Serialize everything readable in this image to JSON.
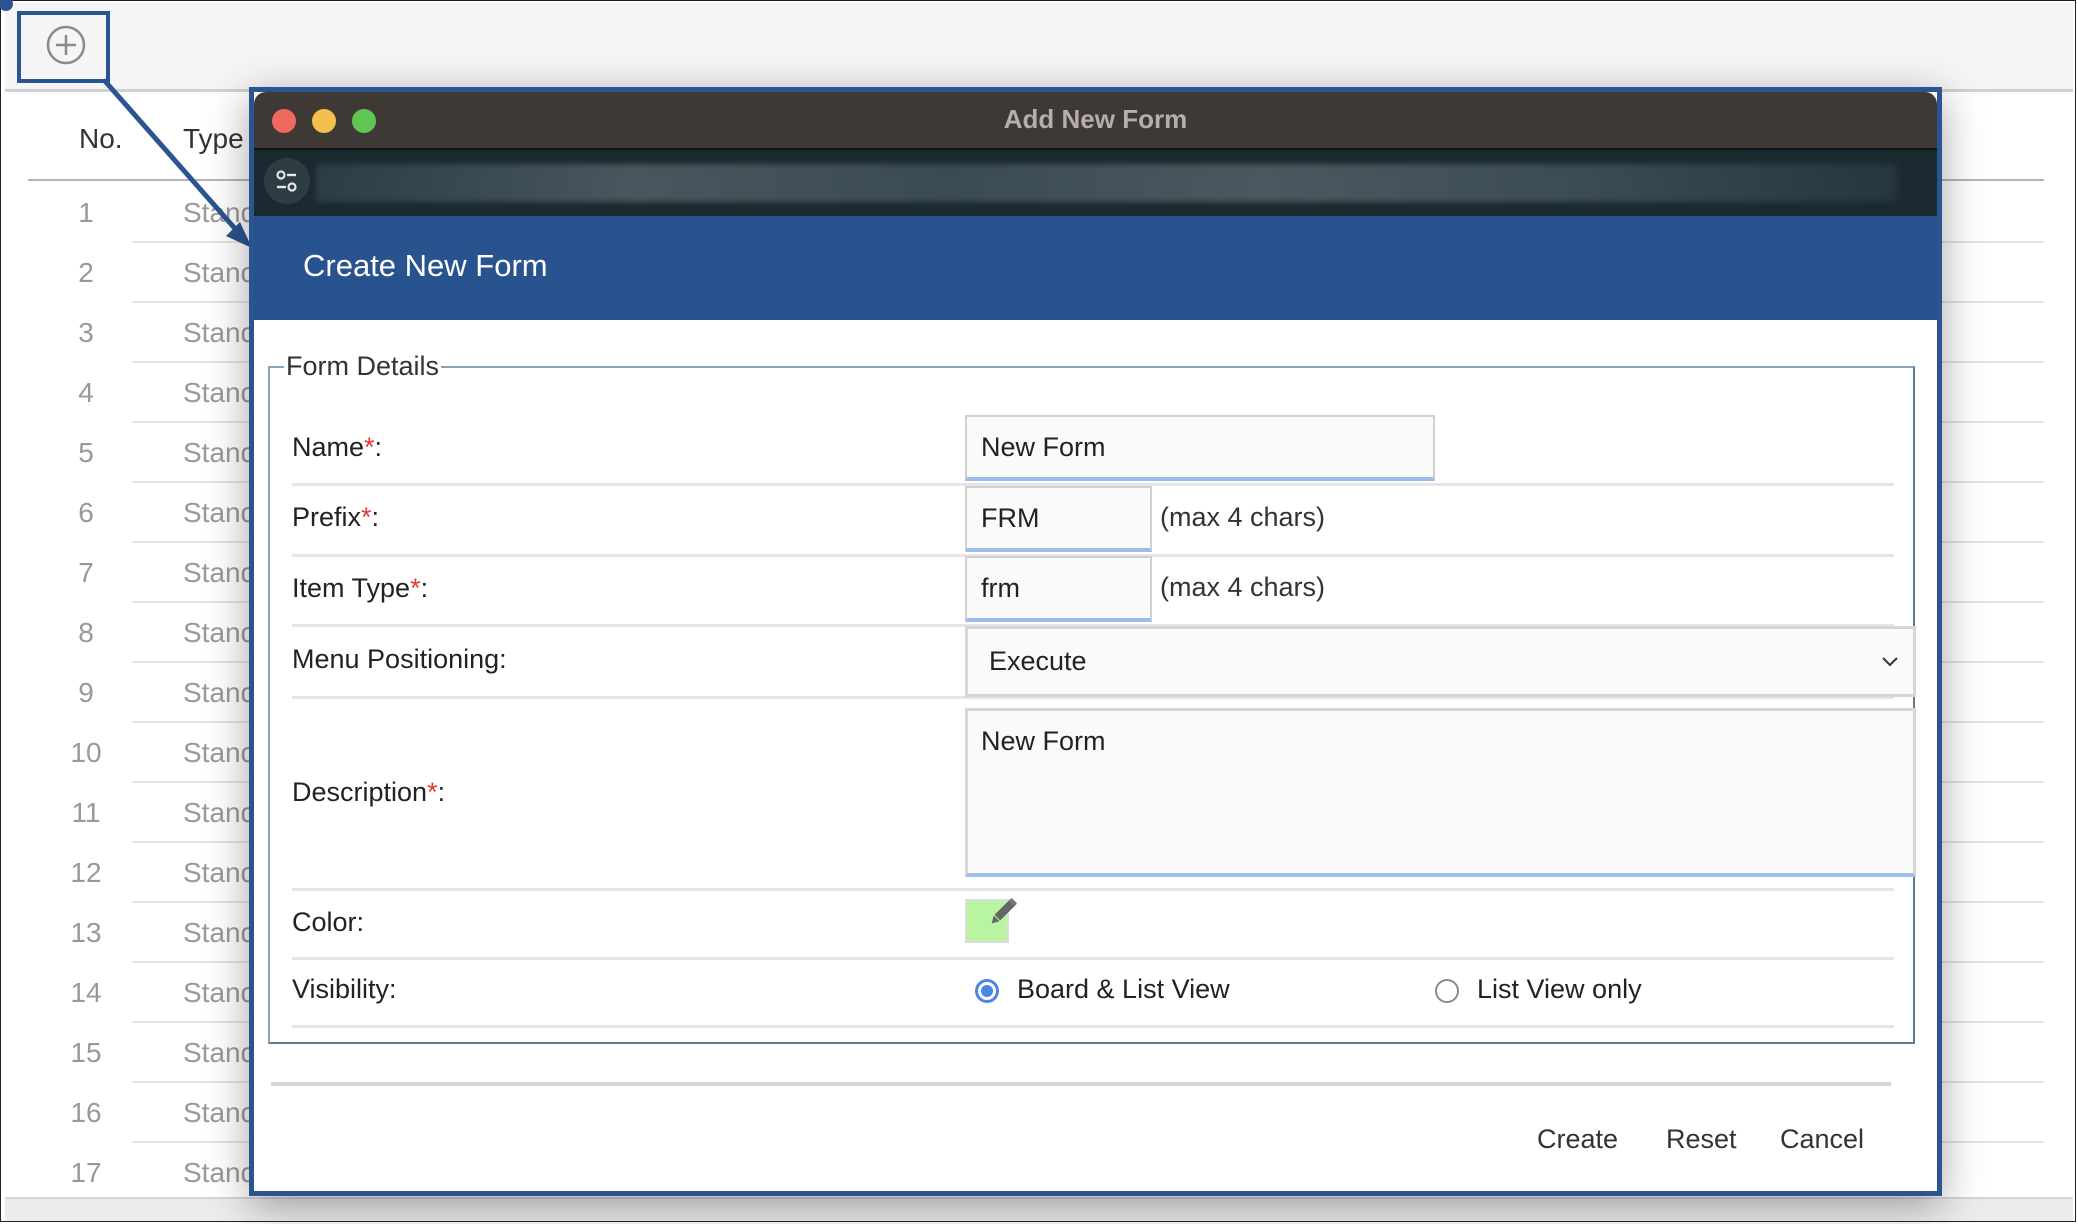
{
  "background": {
    "add_button_icon": "plus-circle-icon",
    "table": {
      "columns": [
        "No.",
        "Type"
      ],
      "rows": [
        {
          "no": "1",
          "type": "Stand"
        },
        {
          "no": "2",
          "type": "Stand"
        },
        {
          "no": "3",
          "type": "Stand"
        },
        {
          "no": "4",
          "type": "Stand"
        },
        {
          "no": "5",
          "type": "Stand"
        },
        {
          "no": "6",
          "type": "Stand"
        },
        {
          "no": "7",
          "type": "Stand"
        },
        {
          "no": "8",
          "type": "Stand"
        },
        {
          "no": "9",
          "type": "Stand"
        },
        {
          "no": "10",
          "type": "Stand"
        },
        {
          "no": "11",
          "type": "Stand"
        },
        {
          "no": "12",
          "type": "Stand"
        },
        {
          "no": "13",
          "type": "Stand"
        },
        {
          "no": "14",
          "type": "Stand"
        },
        {
          "no": "15",
          "type": "Stand"
        },
        {
          "no": "16",
          "type": "Stand"
        },
        {
          "no": "17",
          "type": "Stand"
        }
      ]
    }
  },
  "window": {
    "title": "Add New Form",
    "toolbar_icon": "sliders-icon",
    "url_blurred": "blurred address"
  },
  "dialog": {
    "header_title": "Create New Form",
    "fieldset_legend": "Form Details",
    "fields": {
      "name": {
        "label": "Name",
        "required": "*",
        "suffix": ":",
        "value": "New Form"
      },
      "prefix": {
        "label": "Prefix",
        "required": "*",
        "suffix": ":",
        "value": "FRM",
        "hint": "(max 4 chars)"
      },
      "item_type": {
        "label": "Item Type",
        "required": "*",
        "suffix": ":",
        "value": "frm",
        "hint": "(max 4 chars)"
      },
      "menu_positioning": {
        "label": "Menu Positioning:",
        "value": "Execute"
      },
      "description": {
        "label": "Description",
        "required": "*",
        "suffix": ":",
        "value": "New Form"
      },
      "color": {
        "label": "Color:",
        "value": "#b9f5a0"
      },
      "visibility": {
        "label": "Visibility:",
        "options": [
          {
            "label": "Board & List View",
            "checked": true
          },
          {
            "label": "List View only",
            "checked": false
          }
        ]
      }
    },
    "buttons": {
      "create": "Create",
      "reset": "Reset",
      "cancel": "Cancel"
    }
  },
  "colors": {
    "accent": "#28538f",
    "highlight_border": "#2a5590",
    "required": "#e53935",
    "radio_checked": "#4a86e8"
  }
}
